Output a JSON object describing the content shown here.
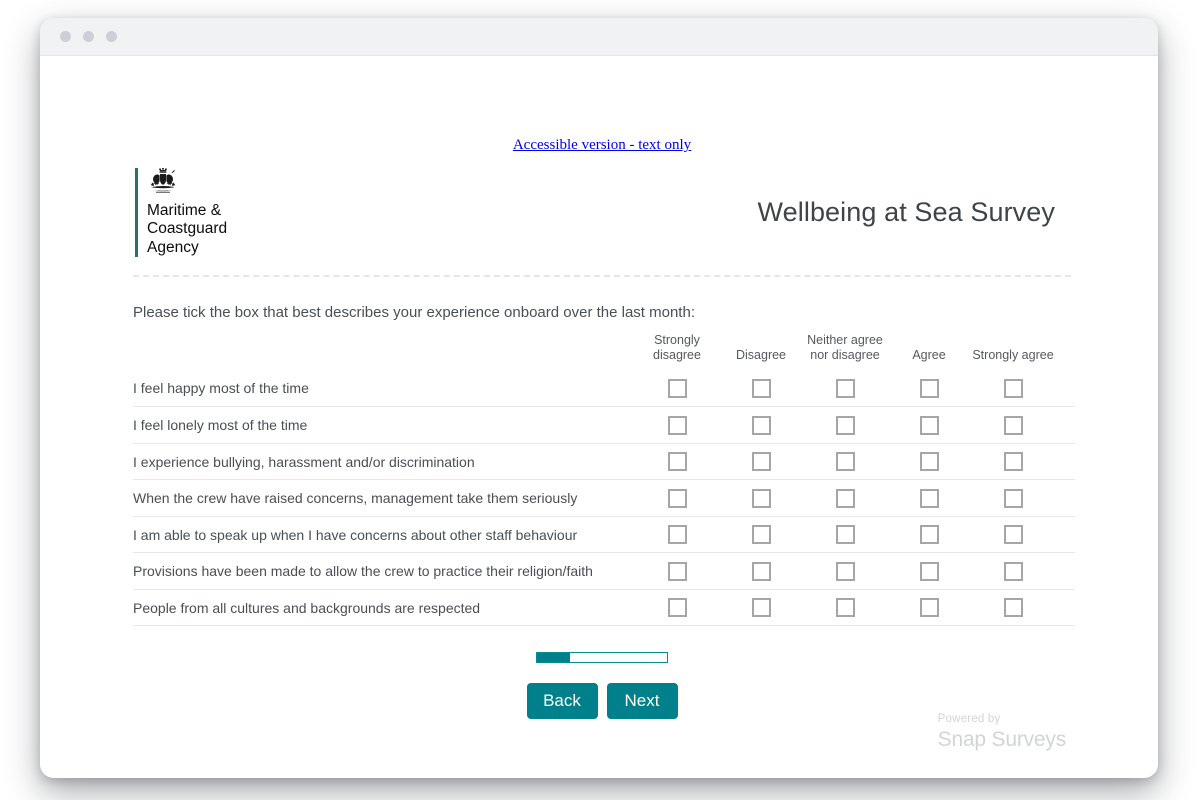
{
  "window": {
    "traffic_lights": [
      "close-dot",
      "minimize-dot",
      "maximize-dot"
    ]
  },
  "accessible_link": {
    "label": "Accessible version - text only"
  },
  "header": {
    "logo": {
      "crest_icon": "royal-coat-of-arms-crest",
      "organisation": "Maritime &\nCoastguard\nAgency",
      "rule_color": "#2f6f6b"
    },
    "title": "Wellbeing at Sea Survey"
  },
  "instruction": "Please tick the box that best describes your experience onboard over the last month:",
  "grid": {
    "question_column_header": "",
    "columns": [
      "Strongly disagree",
      "Disagree",
      "Neither agree nor disagree",
      "Agree",
      "Strongly agree"
    ],
    "rows": [
      {
        "question": "I feel happy most of the time",
        "selected": null
      },
      {
        "question": "I feel lonely most of the time",
        "selected": null
      },
      {
        "question": "I experience bullying, harassment and/or discrimination",
        "selected": null
      },
      {
        "question": "When the crew have raised concerns, management take them seriously",
        "selected": null
      },
      {
        "question": "I am able to speak up when I have concerns about other staff behaviour",
        "selected": null
      },
      {
        "question": "Provisions have been made to allow the crew to practice their religion/faith",
        "selected": null
      },
      {
        "question": "People from all cultures and backgrounds are respected",
        "selected": null
      }
    ]
  },
  "progress": {
    "percent": 25,
    "fill_color": "#00808a",
    "track_border_color": "#0a8a93"
  },
  "buttons": {
    "back_label": "Back",
    "next_label": "Next",
    "color": "#00808a"
  },
  "footer": {
    "powered_by": "Powered by",
    "vendor": "Snap Surveys"
  }
}
